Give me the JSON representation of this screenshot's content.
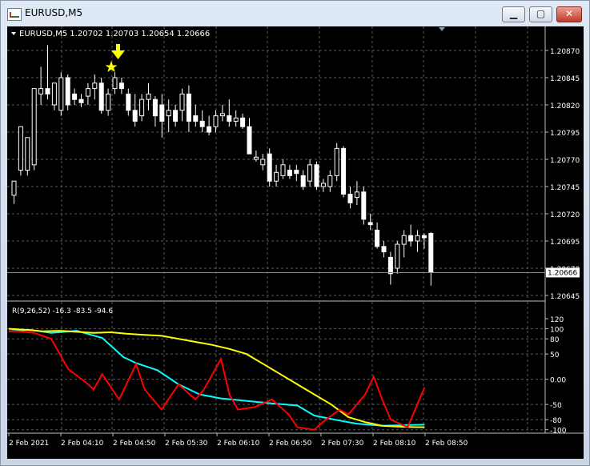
{
  "window": {
    "title": "EURUSD,M5",
    "minimize_glyph": "▁",
    "maximize_glyph": "▢",
    "close_glyph": "✕"
  },
  "main_chart": {
    "header": "EURUSD,M5  1.20702 1.20703 1.20654 1.20666",
    "current_price_label": "1.20666",
    "price_ticks": [
      "1.20870",
      "1.20845",
      "1.20820",
      "1.20795",
      "1.20770",
      "1.20745",
      "1.20720",
      "1.20695",
      "1.20670",
      "1.20645"
    ],
    "arrow_icon": "down-arrow-icon",
    "star_icon": "star-icon",
    "colors": {
      "background": "#000000",
      "candles": "#ffffff",
      "grid": "#5a5a5a",
      "markers": "#ffff00"
    }
  },
  "indicator": {
    "header": "R(9,26,52) -16.3 -83.5 -94.6",
    "ticks": [
      "120",
      "100",
      "80",
      "50",
      "0.00",
      "-50",
      "-80",
      "-100"
    ],
    "colors": {
      "fast": "#ff0000",
      "mid": "#00ffff",
      "slow": "#ffff00"
    }
  },
  "time_axis": {
    "labels": [
      "2 Feb 2021",
      "2 Feb 04:10",
      "2 Feb 04:50",
      "2 Feb 05:30",
      "2 Feb 06:10",
      "2 Feb 06:50",
      "2 Feb 07:30",
      "2 Feb 08:10",
      "2 Feb 08:50"
    ]
  },
  "chart_data": [
    {
      "type": "candlestick",
      "title": "EURUSD,M5",
      "ohlc_header": {
        "open": 1.20702,
        "high": 1.20703,
        "low": 1.20654,
        "close": 1.20666
      },
      "ylim": [
        1.2064,
        1.2089
      ],
      "y_ticks": [
        1.2087,
        1.20845,
        1.2082,
        1.20795,
        1.2077,
        1.20745,
        1.2072,
        1.20695,
        1.2067,
        1.20645
      ],
      "current_price": 1.20666,
      "candles": [
        {
          "o": 1.20737,
          "h": 1.20747,
          "l": 1.20729,
          "c": 1.2075
        },
        {
          "o": 1.2076,
          "h": 1.20785,
          "l": 1.20755,
          "c": 1.208
        },
        {
          "o": 1.2076,
          "h": 1.2079,
          "l": 1.20755,
          "c": 1.2079
        },
        {
          "o": 1.20765,
          "h": 1.2082,
          "l": 1.2076,
          "c": 1.20835
        },
        {
          "o": 1.2083,
          "h": 1.20855,
          "l": 1.2082,
          "c": 1.20835
        },
        {
          "o": 1.20835,
          "h": 1.20875,
          "l": 1.20825,
          "c": 1.2083
        },
        {
          "o": 1.2082,
          "h": 1.2084,
          "l": 1.20815,
          "c": 1.2084
        },
        {
          "o": 1.20815,
          "h": 1.2085,
          "l": 1.2081,
          "c": 1.20845
        },
        {
          "o": 1.20845,
          "h": 1.20848,
          "l": 1.20815,
          "c": 1.2082
        },
        {
          "o": 1.2083,
          "h": 1.20835,
          "l": 1.2082,
          "c": 1.20825
        },
        {
          "o": 1.20825,
          "h": 1.2083,
          "l": 1.20818,
          "c": 1.20822
        },
        {
          "o": 1.20828,
          "h": 1.2084,
          "l": 1.2082,
          "c": 1.20835
        },
        {
          "o": 1.20835,
          "h": 1.20848,
          "l": 1.20825,
          "c": 1.2084
        },
        {
          "o": 1.2084,
          "h": 1.20845,
          "l": 1.20812,
          "c": 1.20815
        },
        {
          "o": 1.20815,
          "h": 1.20835,
          "l": 1.2081,
          "c": 1.2083
        },
        {
          "o": 1.20835,
          "h": 1.2085,
          "l": 1.2083,
          "c": 1.20845
        },
        {
          "o": 1.2084,
          "h": 1.20845,
          "l": 1.2083,
          "c": 1.20835
        },
        {
          "o": 1.2083,
          "h": 1.20835,
          "l": 1.2081,
          "c": 1.20815
        },
        {
          "o": 1.20815,
          "h": 1.2083,
          "l": 1.208,
          "c": 1.20805
        },
        {
          "o": 1.2081,
          "h": 1.2083,
          "l": 1.20805,
          "c": 1.20825
        },
        {
          "o": 1.20825,
          "h": 1.2084,
          "l": 1.20815,
          "c": 1.2083
        },
        {
          "o": 1.20825,
          "h": 1.20828,
          "l": 1.208,
          "c": 1.2081
        },
        {
          "o": 1.2082,
          "h": 1.2083,
          "l": 1.2079,
          "c": 1.20805
        },
        {
          "o": 1.2081,
          "h": 1.20825,
          "l": 1.20795,
          "c": 1.20815
        },
        {
          "o": 1.20815,
          "h": 1.2082,
          "l": 1.208,
          "c": 1.20805
        },
        {
          "o": 1.20815,
          "h": 1.20835,
          "l": 1.20805,
          "c": 1.2083
        },
        {
          "o": 1.2083,
          "h": 1.20838,
          "l": 1.20795,
          "c": 1.20805
        },
        {
          "o": 1.2081,
          "h": 1.2082,
          "l": 1.208,
          "c": 1.20805
        },
        {
          "o": 1.20805,
          "h": 1.20815,
          "l": 1.20795,
          "c": 1.208
        },
        {
          "o": 1.208,
          "h": 1.2081,
          "l": 1.20792,
          "c": 1.20795
        },
        {
          "o": 1.208,
          "h": 1.20815,
          "l": 1.20795,
          "c": 1.2081
        },
        {
          "o": 1.2081,
          "h": 1.2082,
          "l": 1.20805,
          "c": 1.20812
        },
        {
          "o": 1.2081,
          "h": 1.20825,
          "l": 1.208,
          "c": 1.20805
        },
        {
          "o": 1.20805,
          "h": 1.20815,
          "l": 1.208,
          "c": 1.20808
        },
        {
          "o": 1.20808,
          "h": 1.20812,
          "l": 1.20798,
          "c": 1.208
        },
        {
          "o": 1.208,
          "h": 1.20808,
          "l": 1.20775,
          "c": 1.20775
        },
        {
          "o": 1.2077,
          "h": 1.20778,
          "l": 1.20768,
          "c": 1.20772
        },
        {
          "o": 1.20765,
          "h": 1.20775,
          "l": 1.2076,
          "c": 1.2077
        },
        {
          "o": 1.20775,
          "h": 1.2078,
          "l": 1.20745,
          "c": 1.2075
        },
        {
          "o": 1.2075,
          "h": 1.20765,
          "l": 1.20745,
          "c": 1.20758
        },
        {
          "o": 1.20755,
          "h": 1.2077,
          "l": 1.20752,
          "c": 1.20765
        },
        {
          "o": 1.2076,
          "h": 1.20765,
          "l": 1.20752,
          "c": 1.20755
        },
        {
          "o": 1.2076,
          "h": 1.20765,
          "l": 1.2075,
          "c": 1.20757
        },
        {
          "o": 1.20755,
          "h": 1.2076,
          "l": 1.20742,
          "c": 1.20745
        },
        {
          "o": 1.2075,
          "h": 1.2077,
          "l": 1.20745,
          "c": 1.20765
        },
        {
          "o": 1.20765,
          "h": 1.20768,
          "l": 1.20742,
          "c": 1.20745
        },
        {
          "o": 1.20745,
          "h": 1.20752,
          "l": 1.2074,
          "c": 1.20748
        },
        {
          "o": 1.20745,
          "h": 1.2076,
          "l": 1.2074,
          "c": 1.20755
        },
        {
          "o": 1.20755,
          "h": 1.20785,
          "l": 1.2075,
          "c": 1.2078
        },
        {
          "o": 1.2078,
          "h": 1.20782,
          "l": 1.20735,
          "c": 1.20738
        },
        {
          "o": 1.20738,
          "h": 1.20745,
          "l": 1.20725,
          "c": 1.2073
        },
        {
          "o": 1.20735,
          "h": 1.2075,
          "l": 1.20728,
          "c": 1.2074
        },
        {
          "o": 1.2074,
          "h": 1.20745,
          "l": 1.2071,
          "c": 1.20715
        },
        {
          "o": 1.20712,
          "h": 1.2072,
          "l": 1.20705,
          "c": 1.2071
        },
        {
          "o": 1.20705,
          "h": 1.20712,
          "l": 1.20688,
          "c": 1.2069
        },
        {
          "o": 1.2069,
          "h": 1.20695,
          "l": 1.2068,
          "c": 1.20685
        },
        {
          "o": 1.2068,
          "h": 1.20685,
          "l": 1.20655,
          "c": 1.20665
        },
        {
          "o": 1.2067,
          "h": 1.20695,
          "l": 1.20665,
          "c": 1.20692
        },
        {
          "o": 1.20692,
          "h": 1.20705,
          "l": 1.2068,
          "c": 1.207
        },
        {
          "o": 1.207,
          "h": 1.2071,
          "l": 1.2069,
          "c": 1.20695
        },
        {
          "o": 1.20695,
          "h": 1.20705,
          "l": 1.20685,
          "c": 1.207
        },
        {
          "o": 1.207,
          "h": 1.20702,
          "l": 1.20688,
          "c": 1.20698
        },
        {
          "o": 1.20702,
          "h": 1.20703,
          "l": 1.20654,
          "c": 1.20666
        }
      ]
    },
    {
      "type": "line",
      "title": "R(9,26,52)",
      "values_header": [
        -16.3,
        -83.5,
        -94.6
      ],
      "ylim": [
        -110,
        120
      ],
      "y_ticks": [
        120,
        100,
        80,
        50,
        0,
        -50,
        -80,
        -100
      ],
      "series": [
        {
          "x": [
            0,
            0.05,
            0.1,
            0.16,
            0.22,
            0.27,
            0.3,
            0.35,
            0.4,
            0.45,
            0.5,
            0.55,
            0.6,
            0.62,
            0.68,
            0.72,
            0.78,
            0.82,
            0.88,
            0.93,
            0.98
          ],
          "values": [
            95,
            98,
            92,
            96,
            82,
            44,
            32,
            18,
            -10,
            -30,
            -38,
            -42,
            -46,
            -48,
            -52,
            -72,
            -82,
            -88,
            -92,
            -91,
            -90
          ]
        },
        {
          "x": [
            0,
            0.04,
            0.08,
            0.12,
            0.16,
            0.2,
            0.24,
            0.28,
            0.32,
            0.36,
            0.4,
            0.44,
            0.48,
            0.52,
            0.56,
            0.6,
            0.64,
            0.68,
            0.72,
            0.76,
            0.8,
            0.84,
            0.88,
            0.92,
            0.96,
            0.98
          ],
          "values": [
            100,
            98,
            95,
            96,
            94,
            92,
            93,
            90,
            88,
            86,
            80,
            74,
            68,
            60,
            50,
            30,
            10,
            -10,
            -30,
            -50,
            -75,
            -85,
            -92,
            -94,
            -95,
            -95
          ]
        },
        {
          "x": [
            0,
            0.02,
            0.06,
            0.1,
            0.14,
            0.18,
            0.2,
            0.22,
            0.26,
            0.3,
            0.32,
            0.36,
            0.4,
            0.44,
            0.46,
            0.5,
            0.52,
            0.54,
            0.58,
            0.62,
            0.66,
            0.68,
            0.72,
            0.74,
            0.78,
            0.8,
            0.84,
            0.86,
            0.88,
            0.9,
            0.94,
            0.98
          ],
          "values": [
            95,
            95,
            92,
            80,
            20,
            -5,
            -20,
            10,
            -40,
            30,
            -20,
            -60,
            -10,
            -40,
            -20,
            40,
            -30,
            -60,
            -55,
            -40,
            -70,
            -95,
            -100,
            -85,
            -60,
            -70,
            -30,
            5,
            -40,
            -80,
            -95,
            -16
          ]
        }
      ]
    }
  ]
}
